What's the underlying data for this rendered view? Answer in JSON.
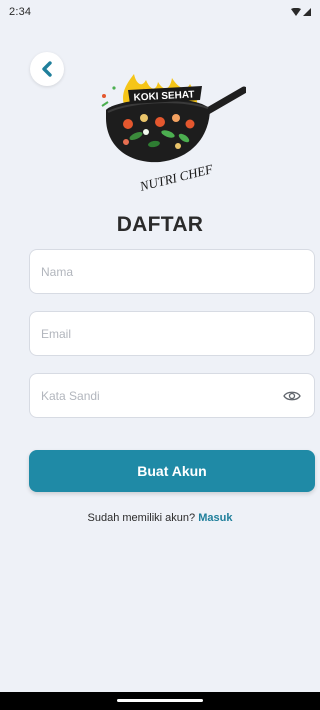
{
  "status_bar": {
    "time": "2:34",
    "icons": [
      "wifi-icon",
      "signal-icon"
    ]
  },
  "header": {
    "back_icon": "chevron-left-icon"
  },
  "logo": {
    "top_text": "KOKI SEHAT",
    "bottom_text": "NUTRI CHEF"
  },
  "form": {
    "title": "DAFTAR",
    "name_placeholder": "Nama",
    "email_placeholder": "Email",
    "password_placeholder": "Kata Sandi",
    "password_toggle_icon": "eye-icon",
    "submit_label": "Buat Akun"
  },
  "footer": {
    "prompt": "Sudah memiliki akun?",
    "login_link": "Masuk"
  },
  "colors": {
    "background": "#eef1f7",
    "primary": "#1f8aa6",
    "link": "#1f7f9b"
  }
}
